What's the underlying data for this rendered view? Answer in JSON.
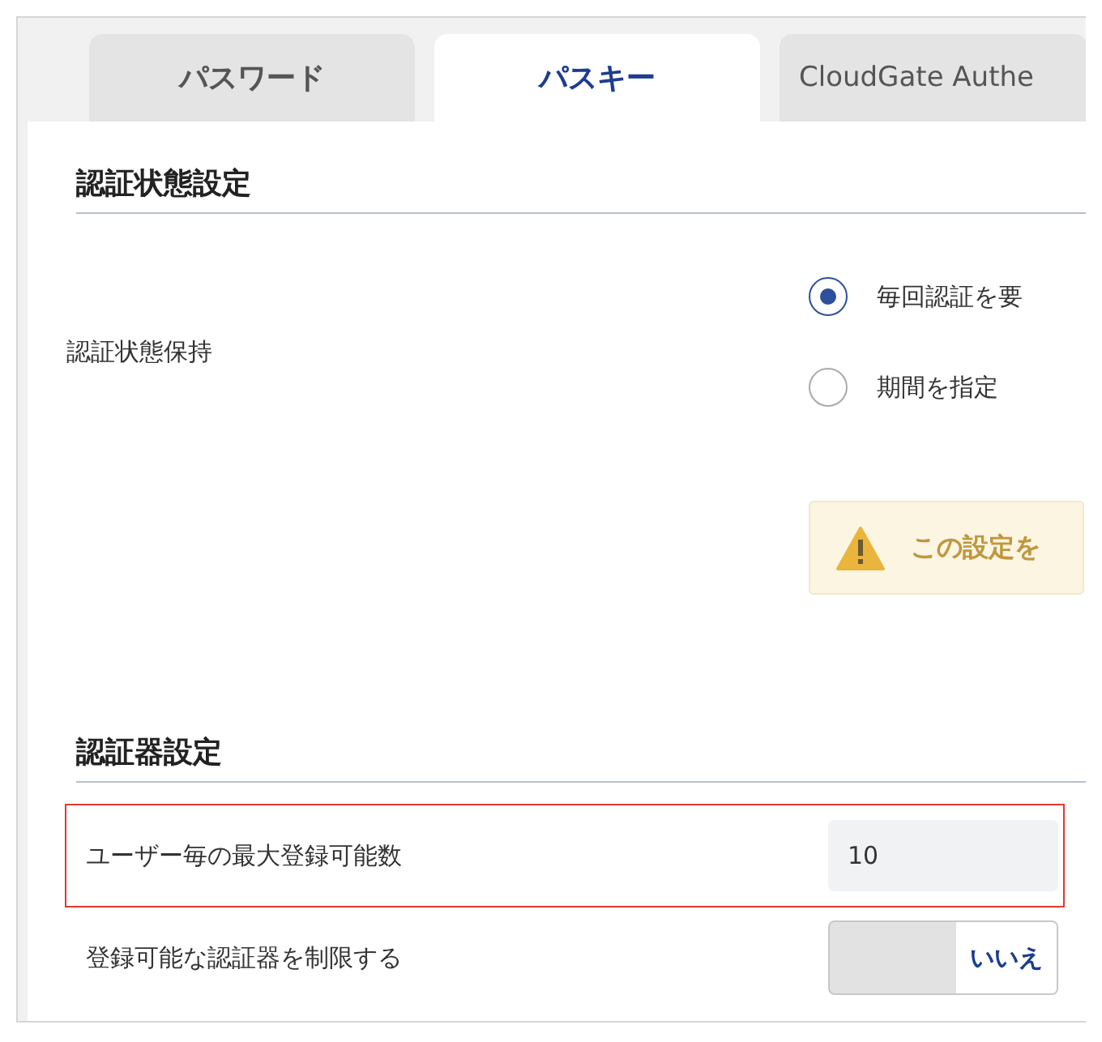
{
  "tabs": [
    {
      "label": "パスワード",
      "selected": false
    },
    {
      "label": "パスキー",
      "selected": true
    },
    {
      "label": "CloudGate Authe",
      "selected": false
    }
  ],
  "sections": [
    {
      "title": "認証状態設定",
      "rows": [
        {
          "kind": "radio",
          "label": "認証状態保持",
          "highlighted": false,
          "options": [
            {
              "label": "毎回認証を要",
              "selected": true
            },
            {
              "label": "期間を指定",
              "selected": false
            }
          ],
          "warning": "この設定を"
        }
      ]
    },
    {
      "title": "認証器設定",
      "rows": [
        {
          "kind": "number",
          "label": "ユーザー毎の最大登録可能数",
          "highlighted": true,
          "value": "10"
        },
        {
          "kind": "toggle",
          "label": "登録可能な認証器を制限する",
          "highlighted": false,
          "on": false,
          "state_label": "いいえ"
        }
      ]
    }
  ]
}
